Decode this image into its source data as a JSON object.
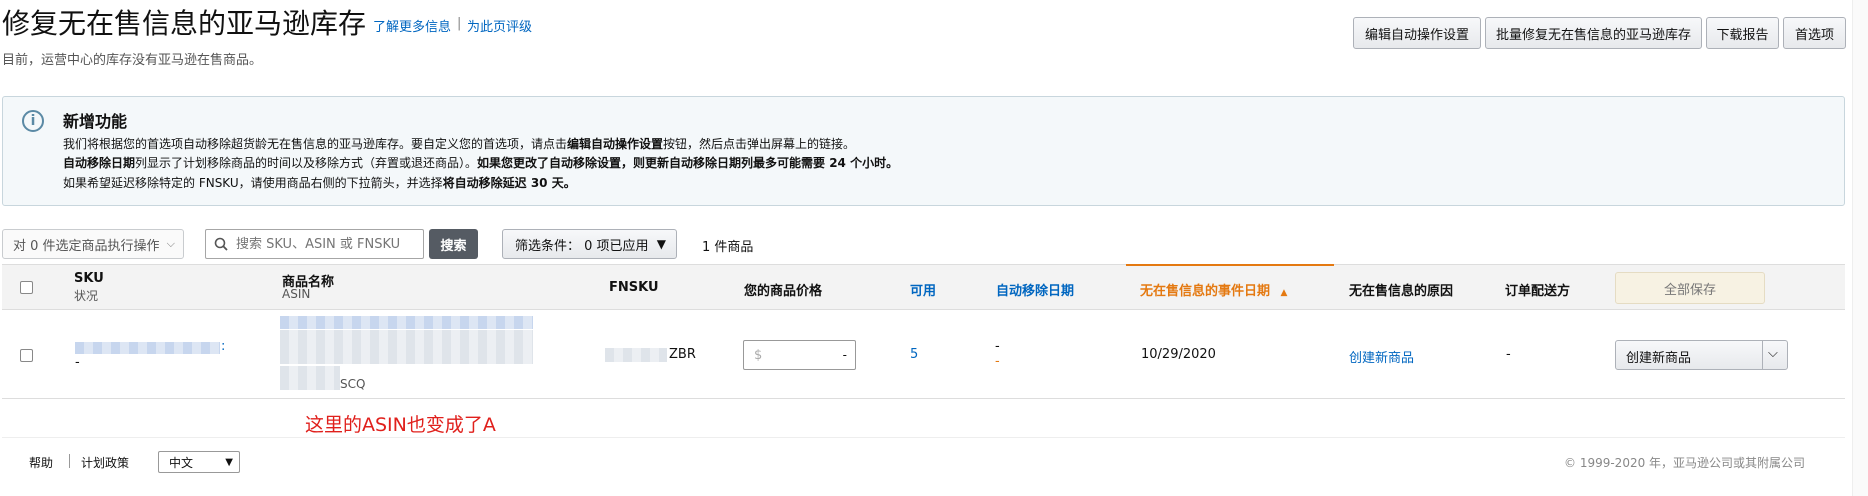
{
  "header": {
    "title": "修复无在售信息的亚马逊库存",
    "learn_more": "了解更多信息",
    "separator": "|",
    "rate_page": "为此页评级",
    "subtitle": "目前，运营中心的库存没有亚马逊在售商品。"
  },
  "actions": {
    "edit_auto": "编辑自动操作设置",
    "bulk_fix": "批量修复无在售信息的亚马逊库存",
    "download": "下载报告",
    "prefs": "首选项"
  },
  "info": {
    "title": "新增功能",
    "line1_a": "我们将根据您的首选项自动移除超货龄无在售信息的亚马逊库存。要自定义您的首选项，请点击",
    "line1_b": "编辑自动操作设置",
    "line1_c": "按钮，然后点击弹出屏幕上的链接。",
    "line2_a": "自动移除日期",
    "line2_b": "列显示了计划移除商品的时间以及移除方式（弃置或退还商品）。",
    "line2_c": "如果您更改了自动移除设置，则更新自动移除日期列最多可能需要 24 个小时。",
    "line3_a": "如果希望延迟移除特定的 FNSKU，请使用商品右侧的下拉箭头，并选择",
    "line3_b": "将自动移除延迟 30 天。"
  },
  "toolbar": {
    "bulk_action": "对 0 件选定商品执行操作",
    "search_placeholder": "搜索 SKU、ASIN 或 FNSKU",
    "search_button": "搜索",
    "filter": "筛选条件： 0 项已应用",
    "item_count": "1 件商品"
  },
  "table": {
    "headers": {
      "sku": "SKU",
      "status": "状况",
      "product_name": "商品名称",
      "asin": "ASIN",
      "fnsku": "FNSKU",
      "price": "您的商品价格",
      "available": "可用",
      "auto_remove": "自动移除日期",
      "event_date": "无在售信息的事件日期",
      "reason": "无在售信息的原因",
      "fulfillment": "订单配送方",
      "save_all": "全部保存"
    },
    "row": {
      "sku_suffix": ":",
      "status": "-",
      "asin_suffix": "SCQ",
      "fnsku_suffix": "ZBR",
      "price_placeholder": "$",
      "price_dash": "-",
      "available": "5",
      "auto_remove_1": "-",
      "auto_remove_2": "-",
      "event_date": "10/29/2020",
      "reason": "创建新商品",
      "fulfillment": "-",
      "action": "创建新商品"
    }
  },
  "annotation": "这里的ASIN也变成了A",
  "footer": {
    "help": "帮助",
    "policy": "计划政策",
    "language": "中文",
    "copyright": "© 1999-2020 年，亚马逊公司或其附属公司"
  },
  "colors": {
    "link": "#0066c0",
    "sort_accent": "#e47911",
    "annotation": "#e0201c"
  }
}
